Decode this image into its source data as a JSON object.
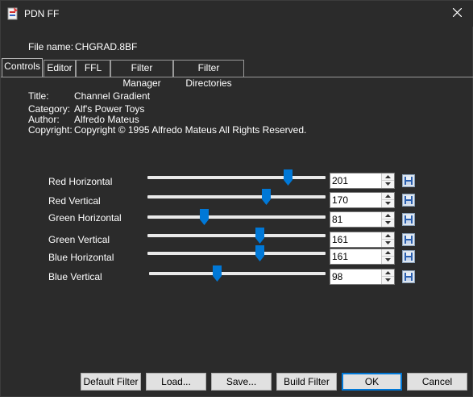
{
  "window": {
    "title": "PDN FF",
    "app_icon": "pdn-ff-app-icon",
    "close_icon": "close-icon"
  },
  "file": {
    "label": "File name:",
    "value": "CHGRAD.8BF"
  },
  "tabs": [
    {
      "label": "Controls",
      "active": true
    },
    {
      "label": "Editor",
      "active": false
    },
    {
      "label": "FFL",
      "active": false
    },
    {
      "label": "Filter Manager",
      "active": false
    },
    {
      "label": "Filter Directories",
      "active": false
    }
  ],
  "info": {
    "title_label": "Title:",
    "title_value": "Channel Gradient",
    "category_label": "Category:",
    "category_value": "Alf's Power Toys",
    "author_label": "Author:",
    "author_value": "Alfredo Mateus",
    "copyright_label": "Copyright:",
    "copyright_value": "Copyright © 1995 Alfredo Mateus  All Rights Reserved."
  },
  "controls": [
    {
      "label": "Red Horizontal",
      "value": "201",
      "level": 201,
      "max": 255
    },
    {
      "label": "Red Vertical",
      "value": "170",
      "level": 170,
      "max": 255
    },
    {
      "label": "Green Horizontal",
      "value": "81",
      "level": 81,
      "max": 255
    },
    {
      "label": "Green Vertical",
      "value": "161",
      "level": 161,
      "max": 255
    },
    {
      "label": "Blue Horizontal",
      "value": "161",
      "level": 161,
      "max": 255
    },
    {
      "label": "Blue Vertical",
      "value": "98",
      "level": 98,
      "max": 255
    }
  ],
  "buttons": {
    "default_filter": "Default Filter",
    "load": "Load...",
    "save": "Save...",
    "build_filter": "Build Filter",
    "ok": "OK",
    "cancel": "Cancel"
  },
  "colors": {
    "background": "#2b2b2b",
    "slider_thumb": "#0078d7",
    "track": "#e9e9e9"
  }
}
